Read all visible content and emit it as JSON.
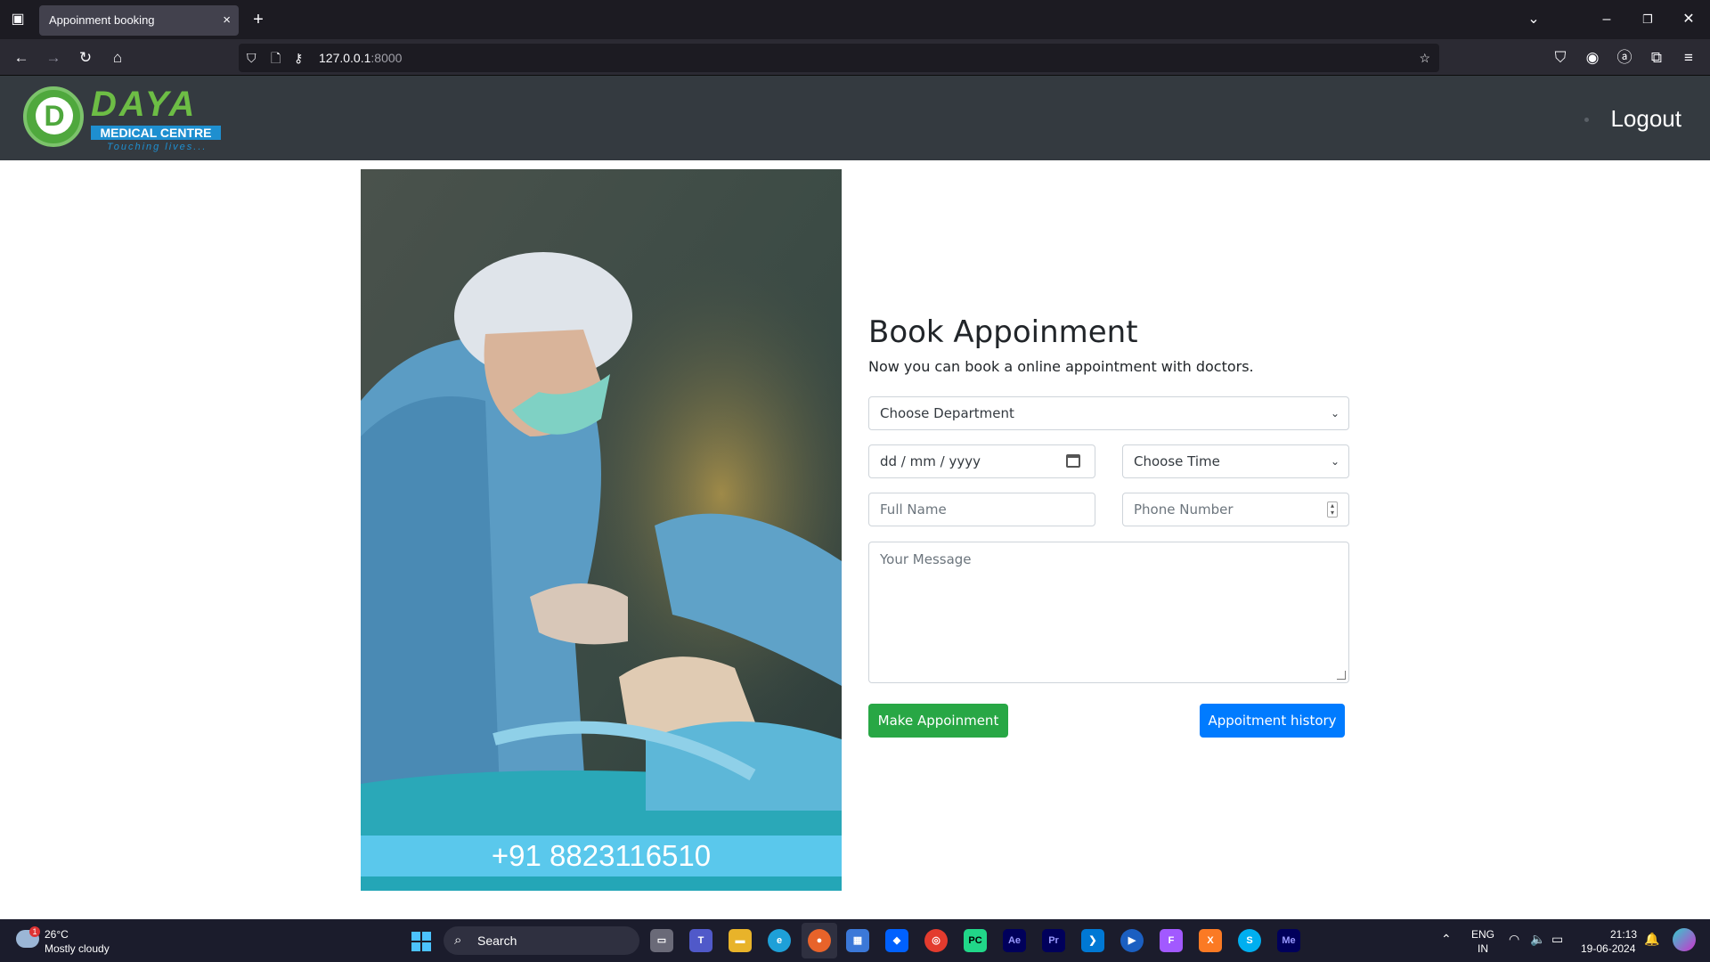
{
  "browser": {
    "tab_title": "Appoinment booking",
    "tab_close": "×",
    "new_tab": "+",
    "url_host": "127.0.0.1",
    "url_port": ":8000"
  },
  "site": {
    "logo": {
      "title": "DAYA",
      "subtitle": "MEDICAL CENTRE",
      "tagline": "Touching lives...",
      "mark": "D"
    },
    "logout_label": "Logout"
  },
  "photo": {
    "phone": "+91 8823116510"
  },
  "form": {
    "title": "Book Appoinment",
    "subtitle": "Now you can book a online appointment with doctors.",
    "department": {
      "selected": "Choose Department"
    },
    "date": {
      "placeholder": "dd / mm / yyyy"
    },
    "time": {
      "selected": "Choose Time"
    },
    "full_name": {
      "placeholder": "Full Name"
    },
    "phone_number": {
      "placeholder": "Phone Number"
    },
    "message": {
      "placeholder": "Your Message"
    },
    "make_button": "Make Appoinment",
    "history_button": "Appoitment history"
  },
  "colors": {
    "navbar": "#343a40",
    "primary": "#007bff",
    "success": "#28a745",
    "phone_band": "#5ac8ec"
  },
  "taskbar": {
    "weather_temp": "26°C",
    "weather_condition": "Mostly cloudy",
    "weather_badge": "1",
    "search_label": "Search",
    "language": "ENG",
    "region": "IN",
    "time": "21:13",
    "date": "19-06-2024",
    "apps": [
      "task-view",
      "teams",
      "file-explorer",
      "edge",
      "firefox",
      "store",
      "dropbox",
      "chrome",
      "pycharm",
      "after-effects",
      "premiere-pro",
      "vscode",
      "media-player",
      "figma",
      "xampp",
      "skype",
      "media-encoder"
    ]
  }
}
